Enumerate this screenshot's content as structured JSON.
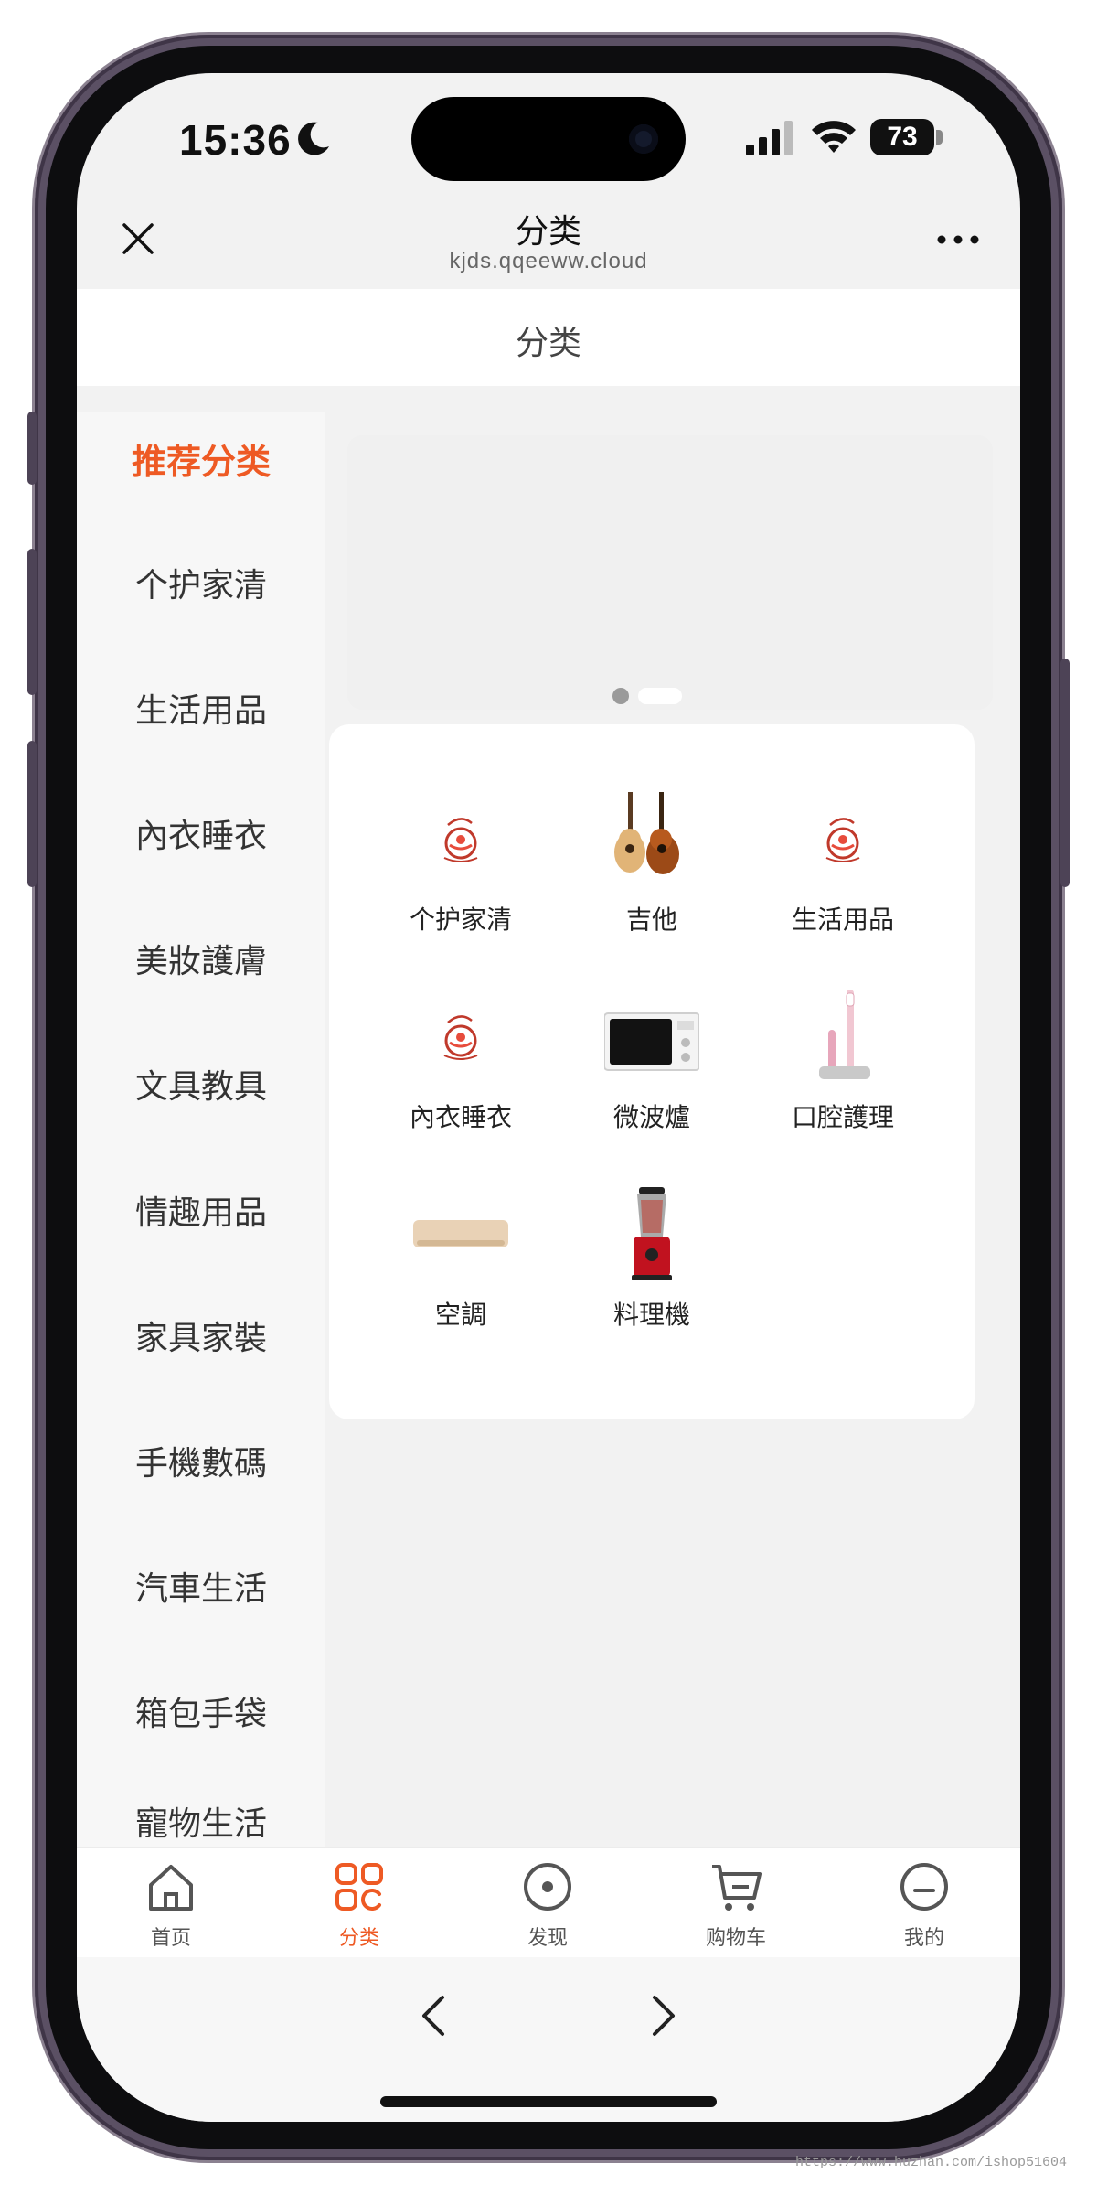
{
  "status_bar": {
    "time": "15:36",
    "battery": "73"
  },
  "browser": {
    "title": "分类",
    "url": "kjds.qqeeww.cloud"
  },
  "page": {
    "title": "分类"
  },
  "sidebar": {
    "items": [
      {
        "label": "推荐分类",
        "active": true
      },
      {
        "label": "个护家清"
      },
      {
        "label": "生活用品"
      },
      {
        "label": "內衣睡衣"
      },
      {
        "label": "美妝護膚"
      },
      {
        "label": "文具教具"
      },
      {
        "label": "情趣用品"
      },
      {
        "label": "家具家裝"
      },
      {
        "label": "手機數碼"
      },
      {
        "label": "汽車生活"
      },
      {
        "label": "箱包手袋"
      },
      {
        "label": "寵物生活"
      }
    ]
  },
  "grid": {
    "items": [
      {
        "label": "个护家清",
        "icon": "logo-icon"
      },
      {
        "label": "吉他",
        "icon": "guitar-icon"
      },
      {
        "label": "生活用品",
        "icon": "logo-icon"
      },
      {
        "label": "內衣睡衣",
        "icon": "logo-icon"
      },
      {
        "label": "微波爐",
        "icon": "microwave-icon"
      },
      {
        "label": "口腔護理",
        "icon": "toothbrush-icon"
      },
      {
        "label": "空調",
        "icon": "air-conditioner-icon"
      },
      {
        "label": "料理機",
        "icon": "blender-icon"
      }
    ]
  },
  "tabbar": {
    "items": [
      {
        "label": "首页",
        "icon": "home-icon"
      },
      {
        "label": "分类",
        "icon": "category-icon",
        "active": true
      },
      {
        "label": "发现",
        "icon": "discover-icon"
      },
      {
        "label": "购物车",
        "icon": "cart-icon"
      },
      {
        "label": "我的",
        "icon": "profile-icon"
      }
    ]
  },
  "watermark": "https://www.huzhan.com/ishop51604",
  "colors": {
    "accent": "#ee5a24",
    "text": "#333333",
    "background": "#f2f2f2"
  }
}
